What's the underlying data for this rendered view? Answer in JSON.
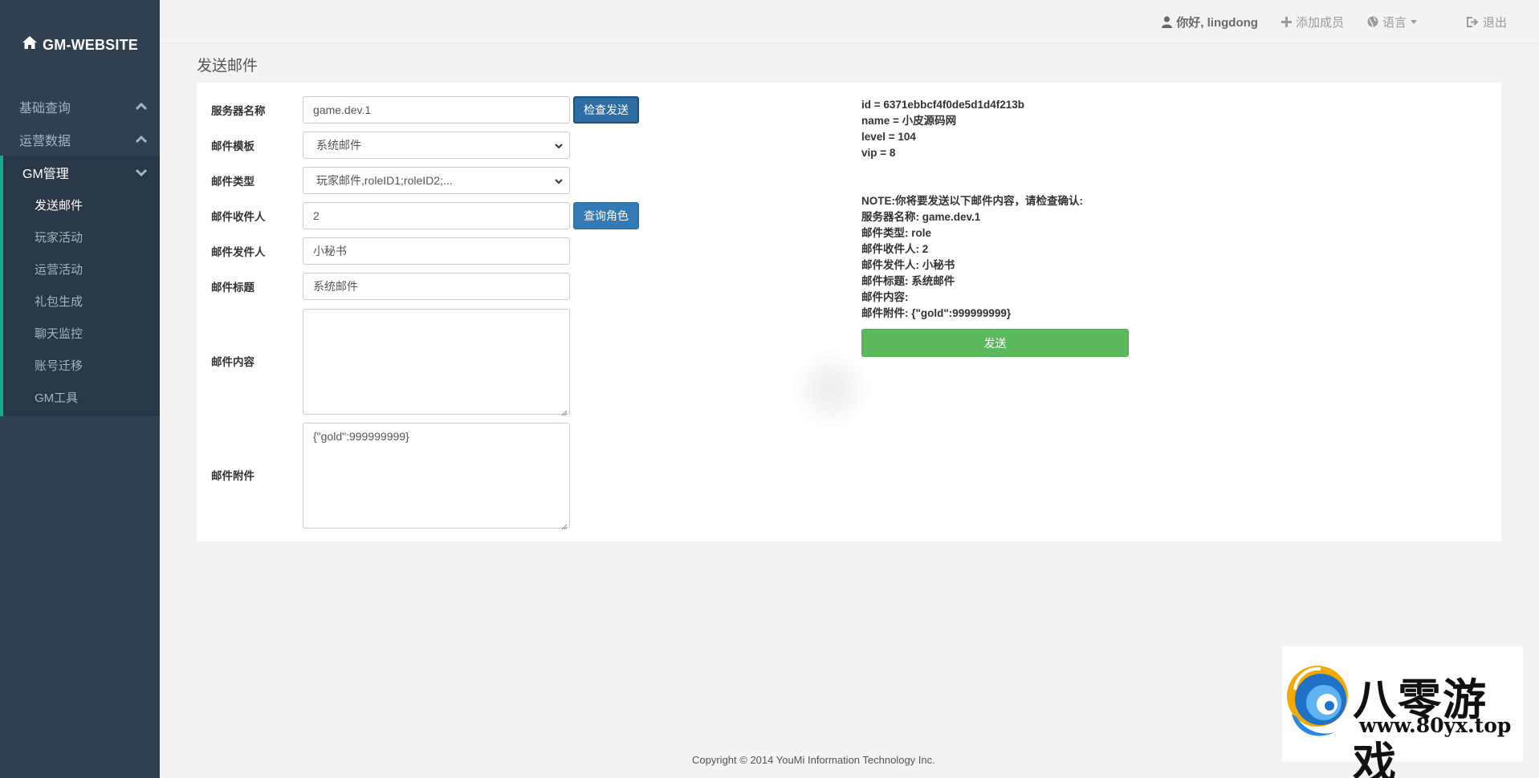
{
  "brand": {
    "title": "GM-WEBSITE",
    "icon": "home-icon"
  },
  "sidebar": {
    "groups": [
      {
        "label": "基础查询",
        "icon": "chevron-up-icon"
      },
      {
        "label": "运营数据",
        "icon": "chevron-up-icon"
      },
      {
        "label": "GM管理",
        "icon": "chevron-down-icon"
      }
    ],
    "items": [
      {
        "label": "发送邮件"
      },
      {
        "label": "玩家活动"
      },
      {
        "label": "运营活动"
      },
      {
        "label": "礼包生成"
      },
      {
        "label": "聊天监控"
      },
      {
        "label": "账号迁移"
      },
      {
        "label": "GM工具"
      }
    ]
  },
  "topbar": {
    "greeting": "你好, lingdong",
    "add_member": "添加成员",
    "language": "语言",
    "logout": "退出"
  },
  "page": {
    "title": "发送邮件"
  },
  "form": {
    "server_label": "服务器名称",
    "server_value": "game.dev.1",
    "check_send_button": "检查发送",
    "template_label": "邮件模板",
    "template_value": "系统邮件",
    "type_label": "邮件类型",
    "type_value": "玩家邮件,roleID1;roleID2;...",
    "recipient_label": "邮件收件人",
    "recipient_value": "2",
    "query_role_button": "查询角色",
    "sender_label": "邮件发件人",
    "sender_value": "小秘书",
    "subject_label": "邮件标题",
    "subject_value": "系统邮件",
    "content_label": "邮件内容",
    "content_value": "",
    "attachment_label": "邮件附件",
    "attachment_value": "{\"gold\":999999999}"
  },
  "role_info": {
    "id": "id = 6371ebbcf4f0de5d1d4f213b",
    "name": "name = 小皮源码网",
    "level": "level = 104",
    "vip": "vip = 8"
  },
  "confirm": {
    "note": "NOTE:你将要发送以下邮件内容，请检查确认:",
    "server": "服务器名称: game.dev.1",
    "type": "邮件类型: role",
    "recipient": "邮件收件人: 2",
    "sender": "邮件发件人: 小秘书",
    "subject": "邮件标题: 系统邮件",
    "content": "邮件内容:",
    "attachment": "邮件附件: {\"gold\":999999999}",
    "send_button": "发送"
  },
  "footer": {
    "copyright": "Copyright © 2014 YouMi Information Technology Inc."
  },
  "watermark": {
    "title": "八零游戏",
    "url": "www.80yx.top"
  },
  "colors": {
    "sidebar": "#2f4050",
    "sidebar_active": "#293846",
    "accent": "#19aa8d",
    "primary": "#337ab7",
    "success": "#5cb85c"
  }
}
